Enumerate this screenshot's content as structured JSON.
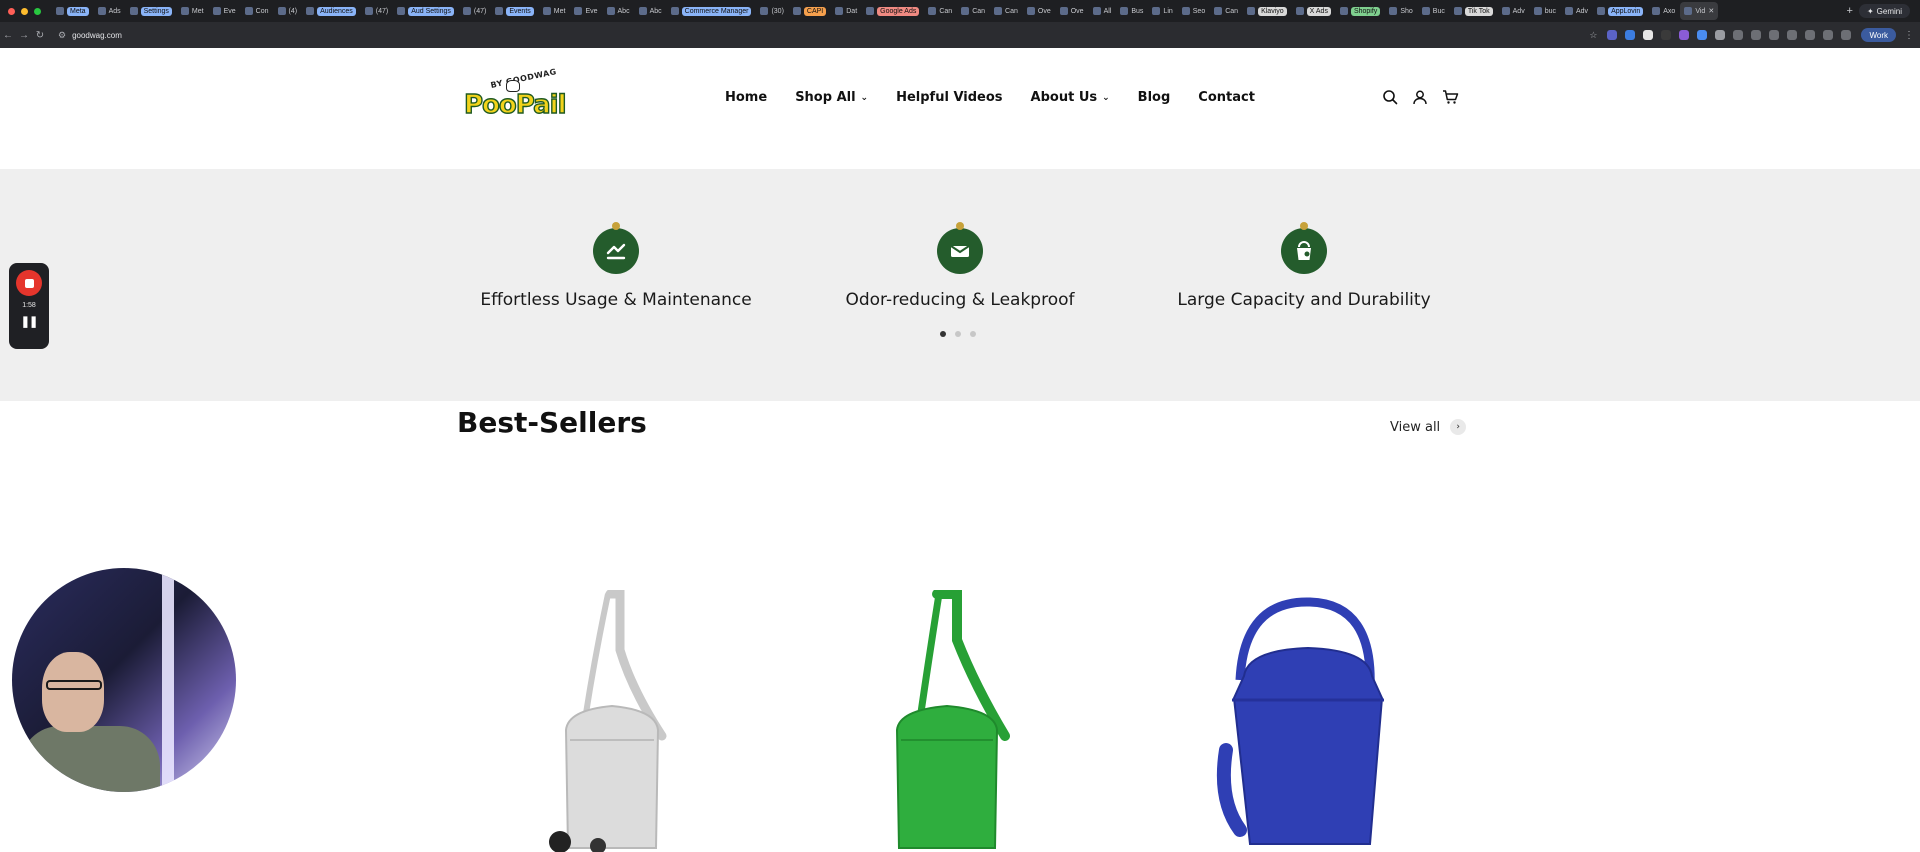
{
  "browser": {
    "tabs": [
      {
        "label": "Meta",
        "pill": "#8ab4f8"
      },
      {
        "label": "Ads",
        "pill": ""
      },
      {
        "label": "Settings",
        "pill": "#8ab4f8"
      },
      {
        "label": "Met",
        "pill": ""
      },
      {
        "label": "Eve",
        "pill": ""
      },
      {
        "label": "Con",
        "pill": ""
      },
      {
        "label": "(4)",
        "pill": ""
      },
      {
        "label": "Audiences",
        "pill": "#8ab4f8"
      },
      {
        "label": "(47)",
        "pill": ""
      },
      {
        "label": "Aud Settings",
        "pill": "#8ab4f8"
      },
      {
        "label": "(47)",
        "pill": ""
      },
      {
        "label": "Events",
        "pill": "#8ab4f8"
      },
      {
        "label": "Met",
        "pill": ""
      },
      {
        "label": "Eve",
        "pill": ""
      },
      {
        "label": "Abc",
        "pill": ""
      },
      {
        "label": "Abc",
        "pill": ""
      },
      {
        "label": "Commerce Manager",
        "pill": "#8ab4f8"
      },
      {
        "label": "(30)",
        "pill": ""
      },
      {
        "label": "CAPI",
        "pill": "#f6a04d"
      },
      {
        "label": "Dat",
        "pill": ""
      },
      {
        "label": "Google Ads",
        "pill": "#f08a82"
      },
      {
        "label": "Can",
        "pill": ""
      },
      {
        "label": "Can",
        "pill": ""
      },
      {
        "label": "Can",
        "pill": ""
      },
      {
        "label": "Ove",
        "pill": ""
      },
      {
        "label": "Ove",
        "pill": ""
      },
      {
        "label": "All",
        "pill": ""
      },
      {
        "label": "Bus",
        "pill": ""
      },
      {
        "label": "Lin",
        "pill": ""
      },
      {
        "label": "Seo",
        "pill": ""
      },
      {
        "label": "Can",
        "pill": ""
      },
      {
        "label": "Klaviyo",
        "pill": "#d9d9d9"
      },
      {
        "label": "X Ads",
        "pill": "#d9d9d9"
      },
      {
        "label": "Shopify",
        "pill": "#7fd08f"
      },
      {
        "label": "Sho",
        "pill": ""
      },
      {
        "label": "Buc",
        "pill": ""
      },
      {
        "label": "Tik Tok",
        "pill": "#d9d9d9"
      },
      {
        "label": "Adv",
        "pill": ""
      },
      {
        "label": "buc",
        "pill": ""
      },
      {
        "label": "Adv",
        "pill": ""
      },
      {
        "label": "AppLovin",
        "pill": "#8ab4f8"
      },
      {
        "label": "Axo",
        "pill": ""
      },
      {
        "label": "Vid",
        "pill": ""
      }
    ],
    "active_tab_close": "✕",
    "new_tab": "+",
    "gemini_label": "Gemini",
    "url": "goodwag.com",
    "profile_label": "Work"
  },
  "site": {
    "logo": {
      "by": "BY GOODWAG",
      "word": "PooPail"
    },
    "nav": [
      {
        "label": "Home",
        "dropdown": false
      },
      {
        "label": "Shop All",
        "dropdown": true
      },
      {
        "label": "Helpful Videos",
        "dropdown": false
      },
      {
        "label": "About Us",
        "dropdown": true
      },
      {
        "label": "Blog",
        "dropdown": false
      },
      {
        "label": "Contact",
        "dropdown": false
      }
    ],
    "features": [
      {
        "title": "Effortless Usage & Maintenance",
        "icon": "hands-icon"
      },
      {
        "title": "Odor-reducing & Leakproof",
        "icon": "seal-icon"
      },
      {
        "title": "Large Capacity and Durability",
        "icon": "bucket-icon"
      }
    ],
    "carousel": {
      "total": 3,
      "active": 0
    },
    "best_sellers": {
      "title": "Best-Sellers",
      "view_all": "View all"
    },
    "products": [
      {
        "color_name": "white",
        "color": "#dcdcdc",
        "stroke": "#b9b9b9"
      },
      {
        "color_name": "green",
        "color": "#2fae3e",
        "stroke": "#1f8a2c"
      },
      {
        "color_name": "blue",
        "color": "#2f3fb4",
        "stroke": "#212e8f"
      }
    ]
  },
  "recorder": {
    "time": "1:58"
  }
}
